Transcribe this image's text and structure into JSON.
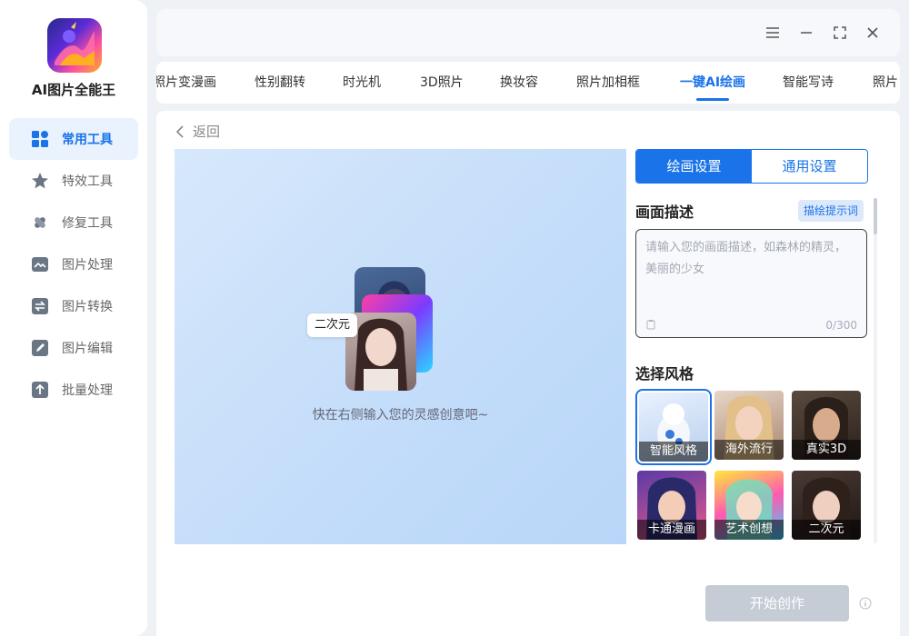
{
  "app": {
    "title": "AI图片全能王"
  },
  "sidebar": {
    "items": [
      {
        "label": "常用工具",
        "icon": "grid-icon",
        "active": true
      },
      {
        "label": "特效工具",
        "icon": "star-icon",
        "active": false
      },
      {
        "label": "修复工具",
        "icon": "bandage-icon",
        "active": false
      },
      {
        "label": "图片处理",
        "icon": "image-icon",
        "active": false
      },
      {
        "label": "图片转换",
        "icon": "convert-icon",
        "active": false
      },
      {
        "label": "图片编辑",
        "icon": "edit-icon",
        "active": false
      },
      {
        "label": "批量处理",
        "icon": "upload-icon",
        "active": false
      }
    ]
  },
  "tabs": [
    {
      "label": "照片变漫画"
    },
    {
      "label": "性别翻转"
    },
    {
      "label": "时光机"
    },
    {
      "label": "3D照片"
    },
    {
      "label": "换妆容"
    },
    {
      "label": "照片加相框"
    },
    {
      "label": "一键AI绘画",
      "active": true
    },
    {
      "label": "智能写诗"
    },
    {
      "label": "照片"
    }
  ],
  "main": {
    "back_label": "返回",
    "preview": {
      "bubble_label": "二次元",
      "hint": "快在右侧输入您的灵感创意吧~"
    },
    "settings": {
      "tab_draw": "绘画设置",
      "tab_general": "通用设置",
      "desc_title": "画面描述",
      "prompt_btn": "描绘提示词",
      "desc_placeholder": "请输入您的画面描述，如森林的精灵，美丽的少女",
      "desc_value": "",
      "counter": "0/300",
      "style_title": "选择风格",
      "styles": [
        {
          "label": "智能风格",
          "selected": true
        },
        {
          "label": "海外流行",
          "selected": false
        },
        {
          "label": "真实3D",
          "selected": false
        },
        {
          "label": "卡通漫画",
          "selected": false
        },
        {
          "label": "艺术创想",
          "selected": false
        },
        {
          "label": "二次元",
          "selected": false
        }
      ]
    },
    "start_label": "开始创作"
  },
  "colors": {
    "accent": "#1a73e8",
    "sidebar_active_bg": "#eaf2fe",
    "start_disabled": "#c5ccd6"
  }
}
